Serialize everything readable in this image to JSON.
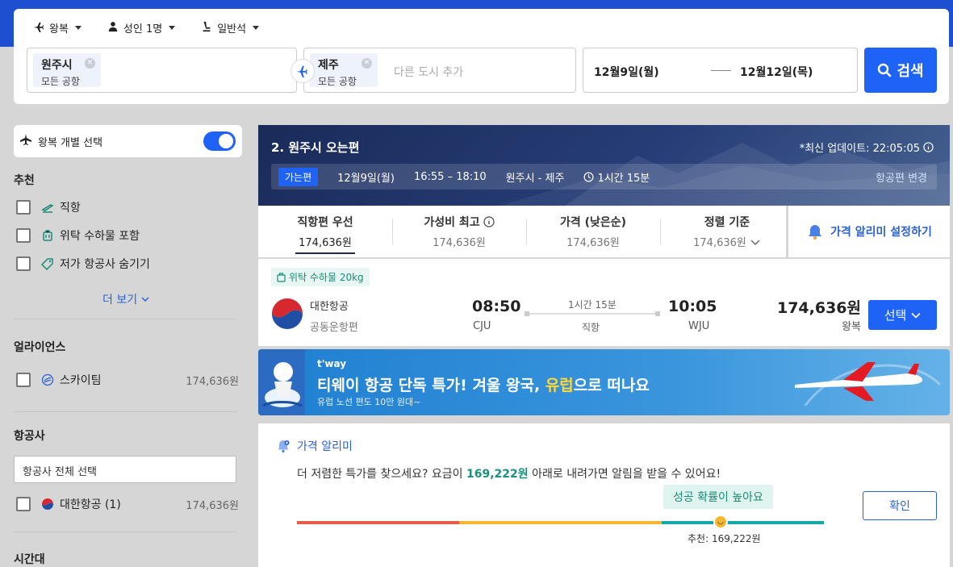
{
  "search": {
    "trip_type": "왕복",
    "passengers": "성인 1명",
    "cabin": "일반석",
    "origin": {
      "city": "원주시",
      "sub": "모든 공항"
    },
    "destination": {
      "city": "제주",
      "sub": "모든 공항"
    },
    "add_city_placeholder": "다른 도시 추가",
    "depart_date": "12월9일(월)",
    "return_date": "12월12일(목)",
    "search_label": "검색"
  },
  "sidebar": {
    "toggle_label": "왕복 개별 선택",
    "recommend_title": "추천",
    "recommend_items": [
      {
        "label": "직항",
        "icon": "direct-flight-icon"
      },
      {
        "label": "위탁 수하물 포함",
        "icon": "luggage-icon"
      },
      {
        "label": "저가 항공사 숨기기",
        "icon": "tag-icon"
      }
    ],
    "more_label": "더 보기",
    "alliance_title": "얼라이언스",
    "alliance": {
      "label": "스카이팀",
      "price": "174,636원"
    },
    "airline_title": "항공사",
    "airline_select_all": "항공사 전체 선택",
    "airline": {
      "label": "대한항공 (1)",
      "price": "174,636원"
    },
    "time_title": "시간대"
  },
  "header": {
    "title": "2. 원주시 오는편",
    "update_text": "*최신 업데이트: 22:05:05",
    "outbound_badge": "가는편",
    "outbound_date": "12월9일(월)",
    "outbound_time": "16:55 – 18:10",
    "outbound_route": "원주시 - 제주",
    "outbound_duration": "1시간 15분",
    "change_link": "항공편 변경"
  },
  "sort_tabs": [
    {
      "label": "직항편 우선",
      "price": "174,636원"
    },
    {
      "label": "가성비 최고",
      "price": "174,636원"
    },
    {
      "label": "가격 (낮은순)",
      "price": "174,636원"
    },
    {
      "label": "정렬 기준",
      "price": "174,636원"
    }
  ],
  "price_alert_cta": "가격 알리미 설정하기",
  "result": {
    "bag_tag": "위탁 수하물 20kg",
    "airline": "대한항공",
    "codeshare": "공동운항편",
    "depart_time": "08:50",
    "depart_code": "CJU",
    "duration": "1시간 15분",
    "stops": "직항",
    "arrive_time": "10:05",
    "arrive_code": "WJU",
    "price": "174,636원",
    "price_type": "왕복",
    "select_label": "선택"
  },
  "ad": {
    "brand": "t'way",
    "headline_pre": "티웨이 항공 단독 특가! 겨울 왕국, ",
    "headline_highlight": "유럽",
    "headline_post": "으로 떠나요",
    "sub": "유럽 노선 편도 10만 원대~"
  },
  "alert": {
    "title": "가격 알리미",
    "msg_pre": "더 저렴한 특가를 찾으세요? 요금이 ",
    "msg_price": "169,222원",
    "msg_post": " 아래로 내려가면 알림을 받을 수 있어요!",
    "badge": "성공 확률이 높아요",
    "recommend": "추천: 169,222원",
    "confirm_label": "확인"
  },
  "colors": {
    "brand_blue": "#1e62f6",
    "topbar": "#1f4fd1",
    "bar_red": "#e85c4a",
    "bar_yellow": "#f7b72c",
    "bar_teal": "#16a8a8"
  }
}
